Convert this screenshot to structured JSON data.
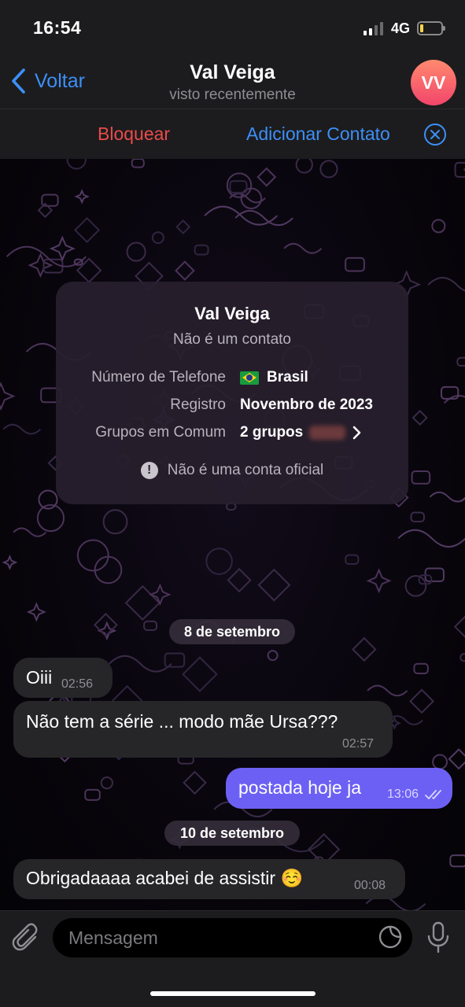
{
  "status_bar": {
    "time": "16:54",
    "network": "4G",
    "signal_bars_active": 2,
    "signal_bars_total": 4,
    "battery_level": 0.15,
    "battery_color": "#f5d547"
  },
  "nav": {
    "back_label": "Voltar",
    "title": "Val Veiga",
    "subtitle": "visto recentemente",
    "avatar_initials": "VV",
    "avatar_colors": [
      "#ff8a6e",
      "#f2456b"
    ]
  },
  "actions": {
    "block_label": "Bloquear",
    "add_contact_label": "Adicionar Contato",
    "close_icon": "close-circle-icon"
  },
  "info_card": {
    "name": "Val Veiga",
    "status": "Não é um contato",
    "rows": [
      {
        "label": "Número de Telefone",
        "value": "Brasil",
        "icon": "brazil-flag-icon"
      },
      {
        "label": "Registro",
        "value": "Novembro de 2023"
      },
      {
        "label": "Grupos em Comum",
        "value": "2 grupos",
        "icon": "chevron-right-icon"
      }
    ],
    "note": "Não é uma conta oficial",
    "note_icon": "exclamation-icon"
  },
  "messages": {
    "date_1": "8 de setembro",
    "m1_text": "Oiii",
    "m1_time": "02:56",
    "m2_text": "Não tem a série ... modo mãe Ursa???",
    "m2_time": "02:57",
    "m3_text": "postada hoje ja",
    "m3_time": "13:06",
    "date_2": "10 de setembro",
    "m4_text": "Obrigadaaaa acabei de assistir ☺️",
    "m4_time": "00:08"
  },
  "input": {
    "placeholder": "Mensagem"
  },
  "colors": {
    "accent_blue": "#3d8ff7",
    "danger_red": "#ec4a4a",
    "outgoing_bubble": "#6c60f4",
    "incoming_bubble": "#262628"
  }
}
